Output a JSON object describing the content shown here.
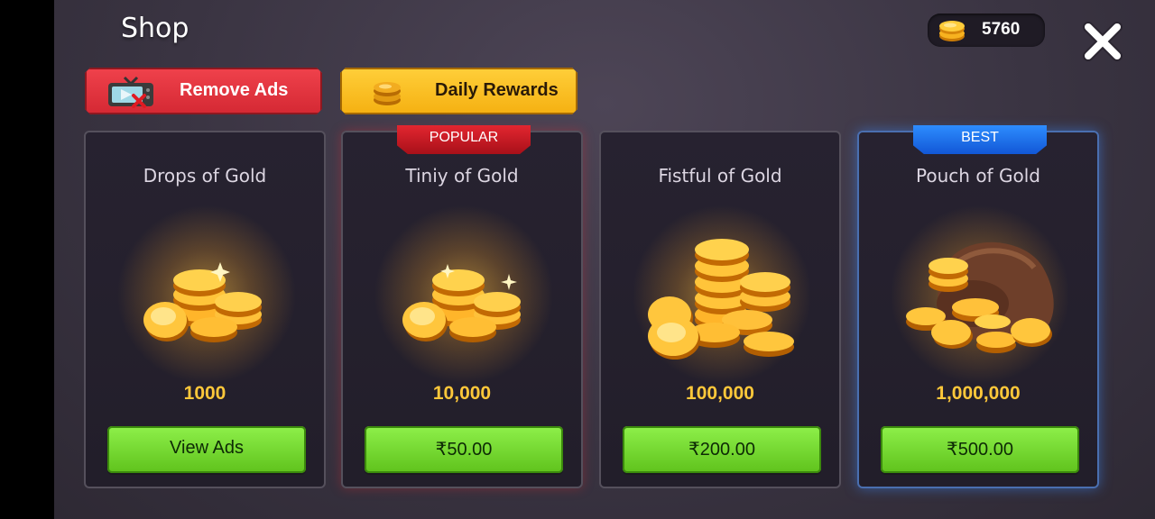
{
  "header": {
    "title": "Shop",
    "coin_balance": "5760"
  },
  "top_buttons": {
    "remove_ads": "Remove Ads",
    "daily_rewards": "Daily Rewards"
  },
  "offers": [
    {
      "name": "Drops of Gold",
      "amount": "1000",
      "button": "View Ads",
      "ribbon": ""
    },
    {
      "name": "Tiniy of Gold",
      "amount": "10,000",
      "button": "₹50.00",
      "ribbon": "POPULAR"
    },
    {
      "name": "Fistful of Gold",
      "amount": "100,000",
      "button": "₹200.00",
      "ribbon": ""
    },
    {
      "name": "Pouch of Gold",
      "amount": "1,000,000",
      "button": "₹500.00",
      "ribbon": "BEST"
    }
  ],
  "colors": {
    "gold": "#ffc83a",
    "green_button": "#6fd62a",
    "red_button": "#e3333d",
    "yellow_button": "#fcbf25",
    "popular_ribbon": "#d01d27",
    "best_ribbon": "#2177f2"
  },
  "icons": [
    "coin-icon",
    "close-icon",
    "tv-no-ads-icon",
    "coin-stack-icon",
    "gold-pile-art",
    "gold-pouch-art"
  ]
}
